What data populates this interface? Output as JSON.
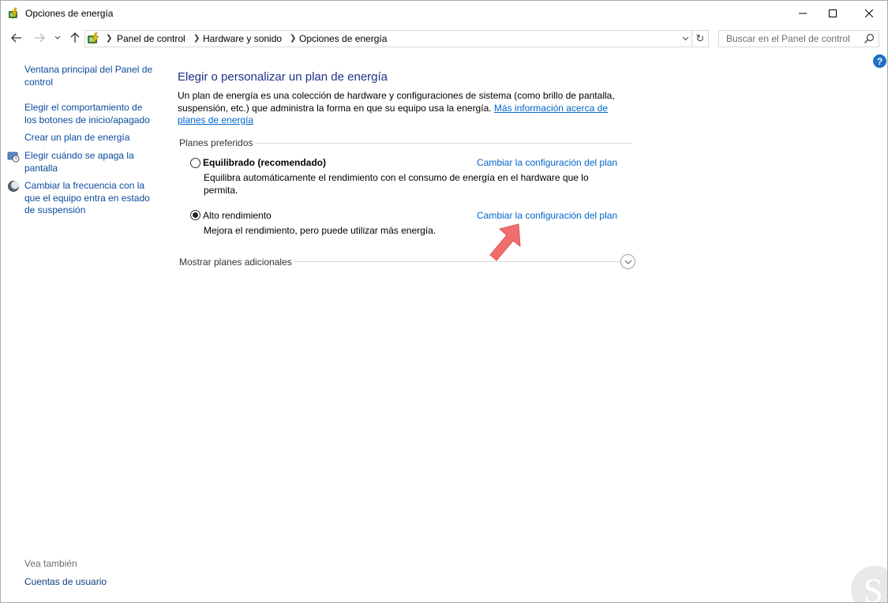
{
  "window": {
    "title": "Opciones de energía"
  },
  "address": {
    "crumbs": [
      "Panel de control",
      "Hardware y sonido",
      "Opciones de energía"
    ],
    "search_placeholder": "Buscar en el Panel de control"
  },
  "sidebar": {
    "links": [
      {
        "label": "Ventana principal del Panel de control"
      },
      {
        "label": "Elegir el comportamiento de los botones de inicio/apagado"
      },
      {
        "label": "Crear un plan de energía"
      },
      {
        "label": "Elegir cuándo se apaga la pantalla"
      },
      {
        "label": "Cambiar la frecuencia con la que el equipo entra en estado de suspensión"
      }
    ],
    "see_also_label": "Vea también",
    "see_also_links": [
      {
        "label": "Cuentas de usuario"
      }
    ]
  },
  "main": {
    "title": "Elegir o personalizar un plan de energía",
    "description": "Un plan de energía es una colección de hardware y configuraciones de sistema (como brillo de pantalla, suspensión, etc.) que administra la forma en que su equipo usa la energía.",
    "more_info_link": "Más información acerca de planes de energía",
    "preferred_label": "Planes preferidos",
    "plans": [
      {
        "name": "Equilibrado (recomendado)",
        "description": "Equilibra automáticamente el rendimiento con el consumo de energía en el hardware que lo permita.",
        "change_link": "Cambiar la configuración del plan",
        "selected": false
      },
      {
        "name": "Alto rendimiento",
        "description": "Mejora el rendimiento, pero puede utilizar más energía.",
        "change_link": "Cambiar la configuración del plan",
        "selected": true
      }
    ],
    "more_plans_label": "Mostrar planes adicionales"
  },
  "colors": {
    "heading": "#1e3287",
    "link": "#0066cc",
    "annotation_arrow": "#f26d6d"
  }
}
